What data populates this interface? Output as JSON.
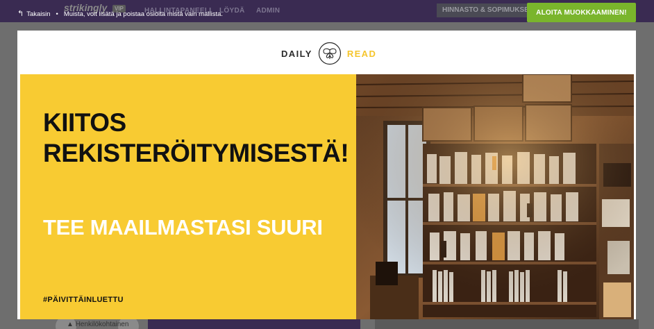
{
  "dashboard": {
    "logo": "strikingly",
    "vip_badge": "VIP",
    "nav": [
      "HALLINTAPANEELI",
      "LÖYDÄ",
      "ADMIN"
    ],
    "pricing_button": "HINNASTO & SOPIMUKSET",
    "person_label": "Henkilökohtainen"
  },
  "overlay": {
    "back_label": "Takaisin",
    "separator": "•",
    "notice": "Muista, voit lisätä ja poistaa osioita mistä vain mallista.",
    "start_button": "ALOITA MUOKKAAMINEN!"
  },
  "site": {
    "brand_left": "DAILY",
    "brand_right": "READ",
    "hero_title": "KIITOS REKISTERÖITYMISESTÄ!",
    "hero_subtitle": "TEE MAAILMASTASI SUURI",
    "hero_tag": "#PÄIVITTÄINLUETTU"
  },
  "colors": {
    "accent_yellow": "#f8cb32",
    "start_green": "#7ab52c",
    "topbar_purple": "#3a2b52"
  }
}
